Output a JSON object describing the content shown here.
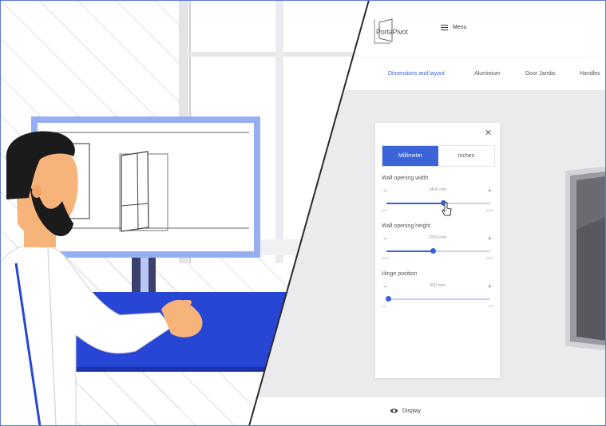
{
  "brand": {
    "logo_text": "PortaPivot"
  },
  "header": {
    "menu_label": "Menu"
  },
  "tabs": [
    {
      "label": "Dimensions and layout",
      "active": true
    },
    {
      "label": "Aluminium",
      "active": false
    },
    {
      "label": "Door Jambs",
      "active": false
    },
    {
      "label": "Handles",
      "active": false
    }
  ],
  "panel": {
    "units": [
      {
        "label": "Millimeter",
        "active": true
      },
      {
        "label": "Inches",
        "active": false
      }
    ],
    "fields": [
      {
        "label": "Wall opening width",
        "value": "1400 mm",
        "min": "500",
        "max": "2000",
        "level": 0.55
      },
      {
        "label": "Wall opening height",
        "value": "2250 mm",
        "min": "2000",
        "max": "2870",
        "level": 0.45
      },
      {
        "label": "Hinge position",
        "value": "300 mm",
        "min": "0.0",
        "max": "700",
        "level": 0.02
      }
    ]
  },
  "footer": {
    "display_label": "Display"
  },
  "colors": {
    "accent": "#3a62d8",
    "illustration_blue": "#2846d6",
    "monitor_frame": "#98aef2"
  },
  "icons": [
    "close-icon",
    "hamburger-icon",
    "eye-icon",
    "plus-icon",
    "minus-icon",
    "cursor-icon"
  ]
}
